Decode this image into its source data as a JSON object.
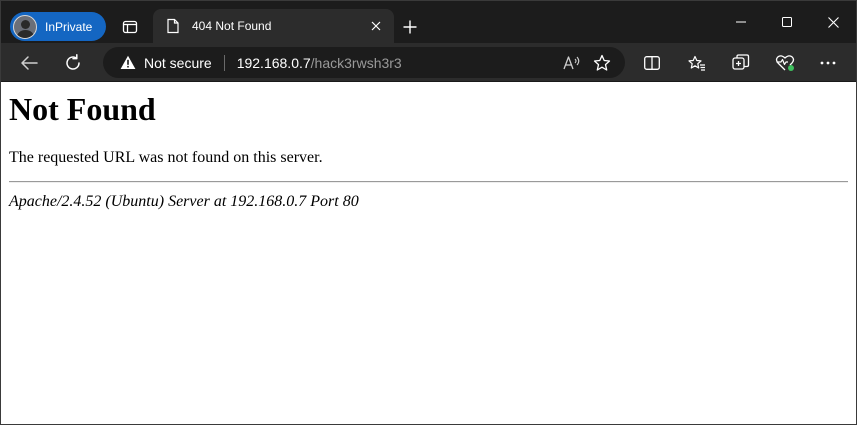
{
  "browser": {
    "inprivate_label": "InPrivate",
    "tab": {
      "title": "404 Not Found"
    },
    "addressbar": {
      "security_label": "Not secure",
      "url_host": "192.168.0.7",
      "url_path": "/hack3rwsh3r3"
    }
  },
  "page": {
    "heading": "Not Found",
    "message": "The requested URL was not found on this server.",
    "server_signature": "Apache/2.4.52 (Ubuntu) Server at 192.168.0.7 Port 80"
  },
  "icons": {
    "tab_actions": "tab-actions-icon",
    "page": "page-icon",
    "close_tab": "close-icon",
    "new_tab": "plus-icon",
    "minimize": "minimize-icon",
    "maximize": "maximize-icon",
    "close_window": "close-icon",
    "back": "back-arrow-icon",
    "refresh": "refresh-icon",
    "warning": "warning-triangle-icon",
    "read_aloud": "read-aloud-icon",
    "favorite": "star-icon",
    "split_screen": "split-screen-icon",
    "favorites": "favorites-list-icon",
    "collections": "collections-icon",
    "browser_essentials": "heart-pulse-icon",
    "more": "more-icon"
  },
  "colors": {
    "tabstrip_bg": "#1c1c1c",
    "toolbar_bg": "#2c2c2c",
    "inprivate_badge": "#1466c2",
    "essentials_badge": "#3fbf5f"
  }
}
